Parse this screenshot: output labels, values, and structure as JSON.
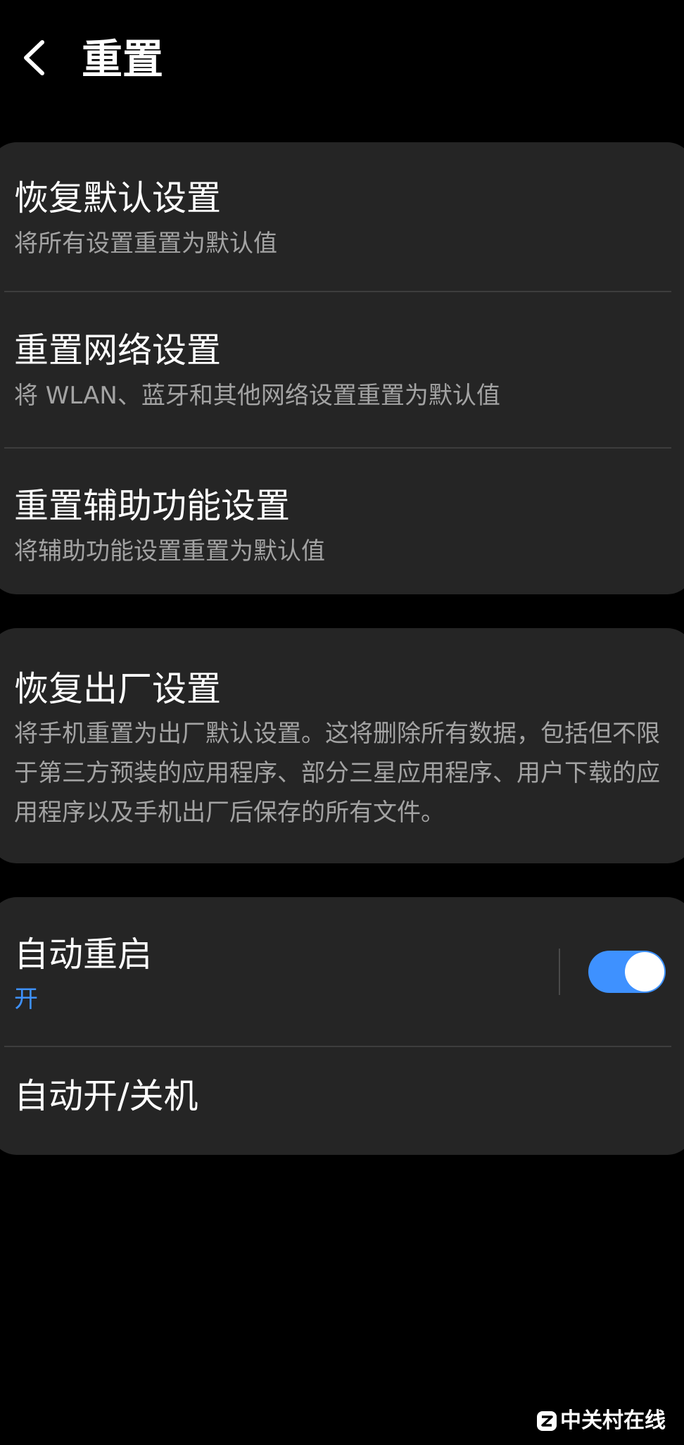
{
  "header": {
    "title": "重置",
    "back_icon": "chevron-left-icon"
  },
  "reset_group": {
    "items": [
      {
        "title": "恢复默认设置",
        "subtitle": "将所有设置重置为默认值"
      },
      {
        "title": "重置网络设置",
        "subtitle": "将 WLAN、蓝牙和其他网络设置重置为默认值"
      },
      {
        "title": "重置辅助功能设置",
        "subtitle": "将辅助功能设置重置为默认值"
      }
    ]
  },
  "factory_reset": {
    "title": "恢复出厂设置",
    "description": "将手机重置为出厂默认设置。这将删除所有数据，包括但不限于第三方预装的应用程序、部分三星应用程序、用户下载的应用程序以及手机出厂后保存的所有文件。"
  },
  "auto_group": {
    "auto_restart": {
      "title": "自动重启",
      "status": "开",
      "enabled": true
    },
    "auto_power": {
      "title": "自动开/关机"
    }
  },
  "watermark": {
    "text": "中关村在线"
  },
  "colors": {
    "background": "#000000",
    "card": "#252525",
    "divider": "#3d3d3d",
    "secondary_text": "#a3a3a3",
    "accent": "#3e91ff"
  }
}
